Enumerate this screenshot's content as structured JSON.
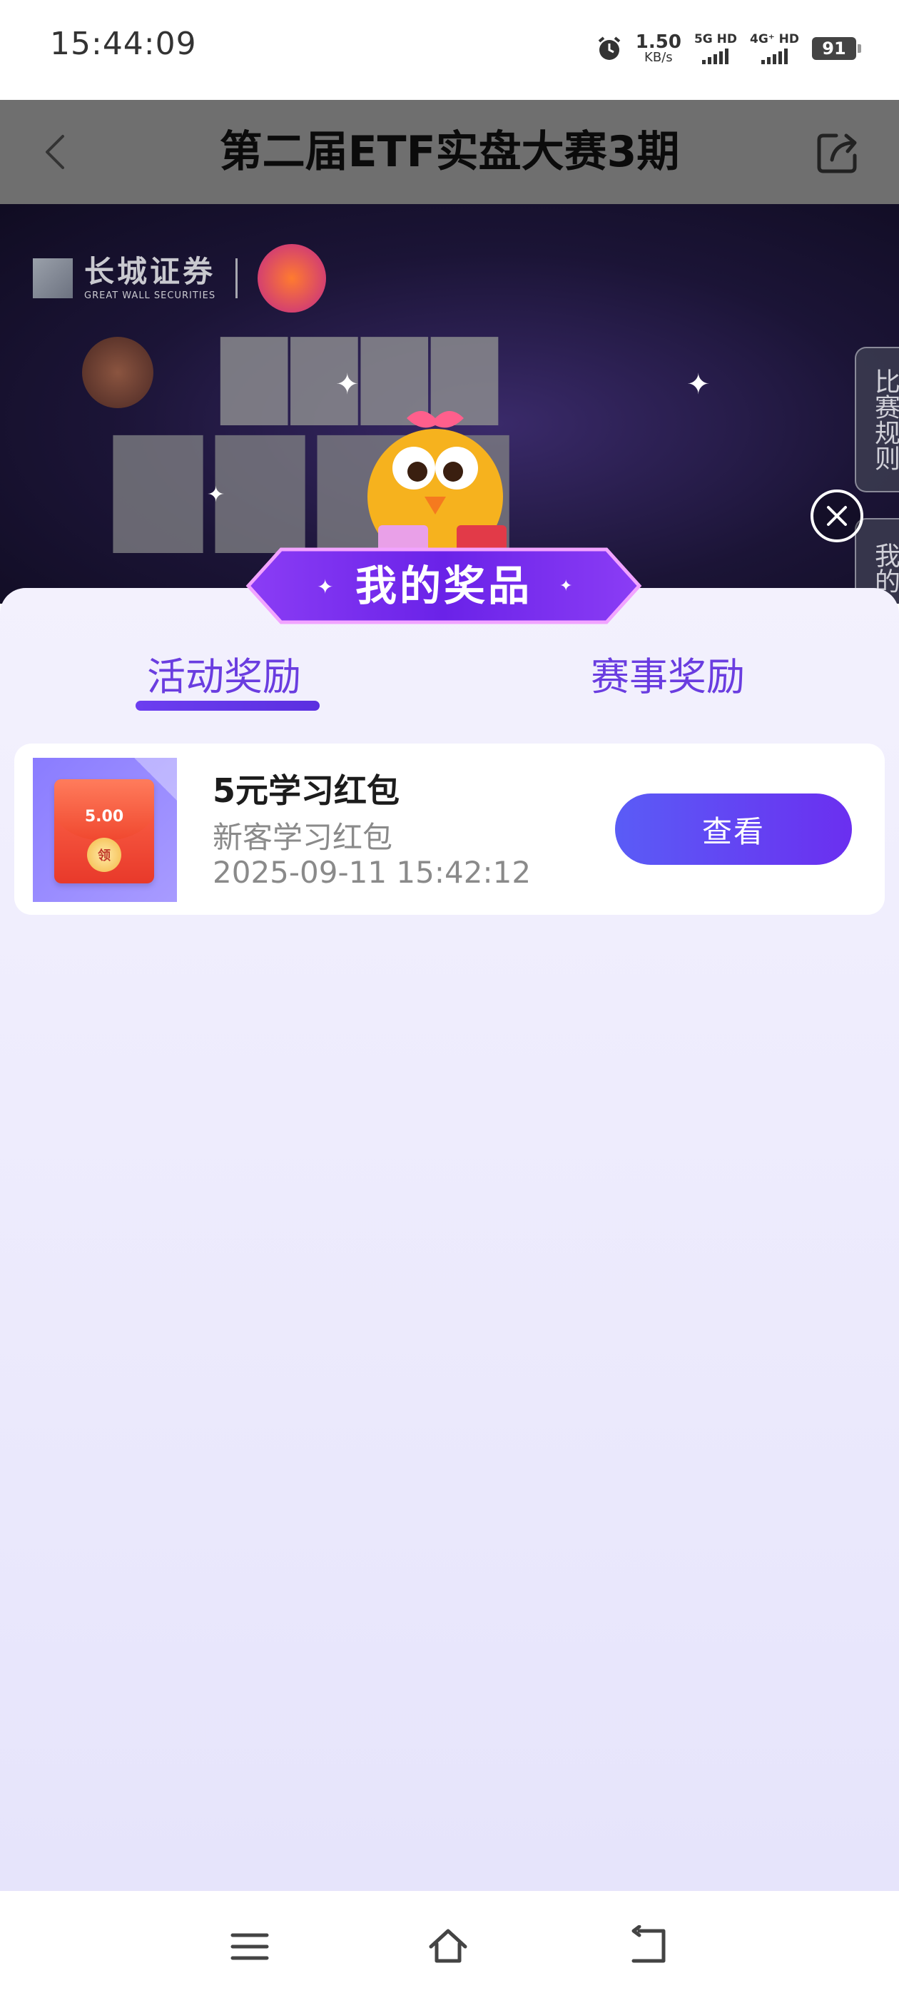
{
  "status_bar": {
    "time": "15:44:09",
    "speed_value": "1.50",
    "speed_unit": "KB/s",
    "sim1_label": "5G HD",
    "sim2_label": "4G⁺ HD",
    "battery": "91",
    "icons": [
      "alarm-icon",
      "signal-icon",
      "battery-icon"
    ]
  },
  "header": {
    "title": "第二届ETF实盘大赛3期",
    "back_icon": "chevron-left-icon",
    "share_icon": "share-icon"
  },
  "banner": {
    "brand_cn": "长城证券",
    "brand_en": "GREAT WALL SECURITIES",
    "rules_tab": "比赛规则",
    "mine_tab": "我的"
  },
  "sheet": {
    "title": "我的奖品",
    "tabs": [
      {
        "label": "活动奖励",
        "active": true
      },
      {
        "label": "赛事奖励",
        "active": false
      }
    ],
    "prizes": [
      {
        "amount": "5.00",
        "seal": "领",
        "name": "5元学习红包",
        "type": "新客学习红包",
        "date": "2025-09-11 15:42:12",
        "action": "查看"
      }
    ]
  },
  "colors": {
    "accent": "#6a3de0",
    "button_start": "#5a5cf6",
    "button_end": "#6b2ff0",
    "sheet_bg": "#eeecfd"
  },
  "navbar": {
    "icons": [
      "menu-icon",
      "home-icon",
      "back-icon"
    ]
  }
}
